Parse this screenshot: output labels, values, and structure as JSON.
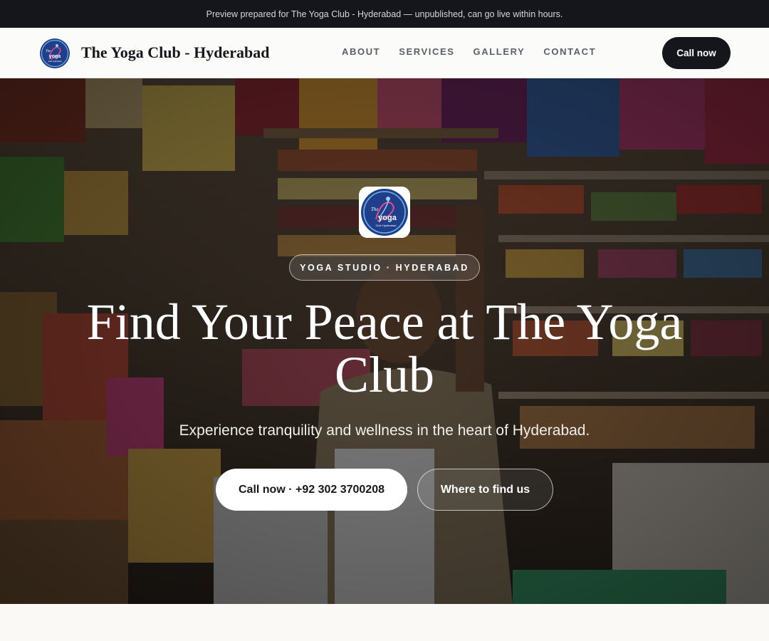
{
  "announcement": {
    "text": "Preview prepared for The Yoga Club - Hyderabad — unpublished, can go live within hours."
  },
  "header": {
    "brand_name": "The Yoga Club - Hyderabad",
    "logo_icon": "yoga-club-logo-icon",
    "logo_text": {
      "the": "The",
      "yoga": "yoga",
      "club": "Club Hyderabad"
    },
    "nav": [
      {
        "label": "ABOUT"
      },
      {
        "label": "SERVICES"
      },
      {
        "label": "GALLERY"
      },
      {
        "label": "CONTACT"
      }
    ],
    "cta_label": "Call now"
  },
  "hero": {
    "background": "photo of a shopkeeper in a crowded general store with shelves of packaged goods",
    "badge": "YOGA STUDIO · HYDERABAD",
    "title": "Find Your Peace at The Yoga Club",
    "subtitle": "Experience tranquility and wellness in the heart of Hyderabad.",
    "primary_button": "Call now · +92 302 3700208",
    "secondary_button": "Where to find us"
  },
  "colors": {
    "dark": "#14161b",
    "nav_link": "#5b6068",
    "page_bg": "#faf9f6",
    "logo_blue": "#1f3f8a"
  }
}
